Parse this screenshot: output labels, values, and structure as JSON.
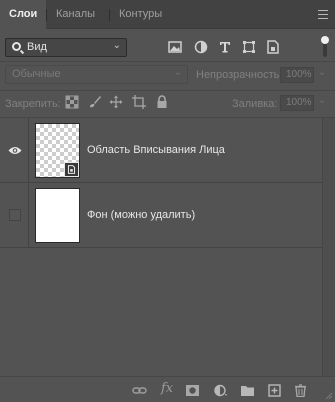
{
  "tabs": [
    {
      "label": "Слои"
    },
    {
      "label": "Каналы"
    },
    {
      "label": "Контуры"
    }
  ],
  "filter": {
    "label": "Вид"
  },
  "blend_mode": {
    "label": "Обычные"
  },
  "opacity": {
    "label": "Непрозрачность:",
    "value": "100%"
  },
  "lock": {
    "label": "Закрепить:"
  },
  "fill": {
    "label": "Заливка:",
    "value": "100%"
  },
  "layers": [
    {
      "name": "Область Вписывания Лица",
      "visible": true,
      "thumbnail": "transparent-smart-object"
    },
    {
      "name": "Фон (можно удалить)",
      "visible": false,
      "thumbnail": "white"
    }
  ],
  "footer": {
    "fx_label": "fx"
  },
  "colors": {
    "panel": "#535353",
    "tabbar": "#424242",
    "text": "#e6e6e6"
  }
}
